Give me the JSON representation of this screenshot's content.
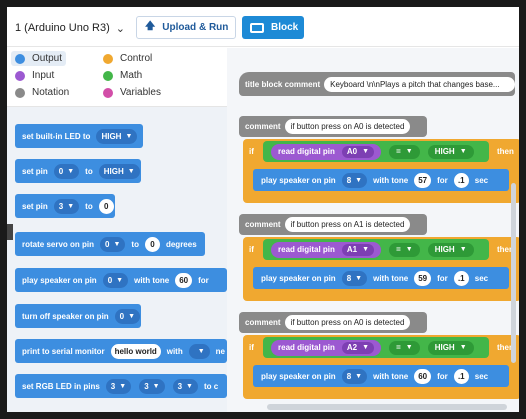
{
  "toolbar": {
    "board_label": "1 (Arduino Uno R3)",
    "upload_label": "Upload & Run",
    "block_label": "Block"
  },
  "categories": [
    {
      "label": "Output",
      "color": "#3d8ee0"
    },
    {
      "label": "Control",
      "color": "#f0a830"
    },
    {
      "label": "Input",
      "color": "#9c59d1"
    },
    {
      "label": "Math",
      "color": "#43b649"
    },
    {
      "label": "Notation",
      "color": "#8a8a8a"
    },
    {
      "label": "Variables",
      "color": "#d24ea8"
    }
  ],
  "palette": {
    "led": {
      "t1": "set built-in LED to",
      "v1": "HIGH"
    },
    "pin": {
      "t1": "set pin",
      "v1": "0",
      "t2": "to",
      "v2": "HIGH"
    },
    "pin_val": {
      "t1": "set pin",
      "v1": "3",
      "t2": "to",
      "v2": "0"
    },
    "servo": {
      "t1": "rotate servo on pin",
      "v1": "0",
      "t2": "to",
      "v2": "0",
      "t3": "degrees"
    },
    "speaker": {
      "t1": "play speaker on pin",
      "v1": "0",
      "t2": "with tone",
      "v2": "60",
      "t3": "for"
    },
    "speaker_off": {
      "t1": "turn off speaker on pin",
      "v1": "0"
    },
    "serial": {
      "t1": "print to serial monitor",
      "v1": "hello world",
      "t2": "with",
      "t3": "ne"
    },
    "rgb": {
      "t1": "set RGB LED in pins",
      "v1": "3",
      "v2": "3",
      "v3": "3",
      "t2": "to c"
    }
  },
  "workspace": {
    "title_comment": {
      "label": "title block comment",
      "value": "Keyboard  \\n\\nPlays a pitch that changes base..."
    },
    "sections": [
      {
        "comment_label": "comment",
        "comment_value": "if button press on A0 is detected",
        "if_kw": "if",
        "then_kw": "then",
        "read": "read digital pin",
        "pin": "A0",
        "op": "=",
        "level": "HIGH",
        "play": "play speaker on pin",
        "spk_pin": "8",
        "with_tone": "with tone",
        "tone": "57",
        "for": "for",
        "dur": ".1",
        "unit": "sec"
      },
      {
        "comment_label": "comment",
        "comment_value": "if button press on A1 is detected",
        "if_kw": "if",
        "then_kw": "then",
        "read": "read digital pin",
        "pin": "A1",
        "op": "=",
        "level": "HIGH",
        "play": "play speaker on pin",
        "spk_pin": "8",
        "with_tone": "with tone",
        "tone": "59",
        "for": "for",
        "dur": ".1",
        "unit": "sec"
      },
      {
        "comment_label": "comment",
        "comment_value": "if button press on A0 is detected",
        "if_kw": "if",
        "then_kw": "then",
        "read": "read digital pin",
        "pin": "A2",
        "op": "=",
        "level": "HIGH",
        "play": "play speaker on pin",
        "spk_pin": "8",
        "with_tone": "with tone",
        "tone": "60",
        "for": "for",
        "dur": ".1",
        "unit": "sec"
      }
    ]
  }
}
